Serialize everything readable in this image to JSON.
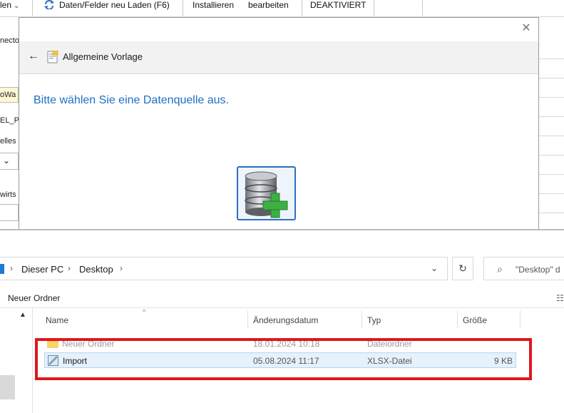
{
  "toolbar": {
    "item_1": "len",
    "reload_label": "Daten/Felder neu Laden (F6)",
    "install_label": "Installieren",
    "edit_label": "bearbeiten",
    "status_label": "DEAKTIVIERT"
  },
  "left_fields": [
    "necto",
    "oWa",
    "EL_PF",
    "elles C",
    "wirts"
  ],
  "dialog": {
    "title": "Allgemeine Vorlage",
    "prompt": "Bitte wählen Sie eine Datenquelle aus."
  },
  "explorer": {
    "breadcrumbs": [
      "Dieser PC",
      "Desktop"
    ],
    "search_placeholder": "\"Desktop\" d",
    "new_folder_label": "Neuer Ordner",
    "columns": {
      "name": "Name",
      "date": "Änderungsdatum",
      "type": "Typ",
      "size": "Größe"
    },
    "files": [
      {
        "name": "Neuer Ordner",
        "date": "18.01.2024 10:18",
        "type": "Dateiordner",
        "size": ""
      },
      {
        "name": "Import",
        "date": "05.08.2024 11:17",
        "type": "XLSX-Datei",
        "size": "9 KB"
      }
    ]
  },
  "colors": {
    "accent_blue": "#1e6fc4",
    "highlight_red": "#e0161e",
    "selection": "#e5f1fb",
    "folder_yellow": "#f5c342",
    "add_green": "#3cb043"
  },
  "icons": [
    "refresh-icon",
    "back-arrow-icon",
    "template-icon",
    "database-add-icon",
    "close-icon",
    "search-icon",
    "folder-icon",
    "xlsx-file-icon"
  ]
}
